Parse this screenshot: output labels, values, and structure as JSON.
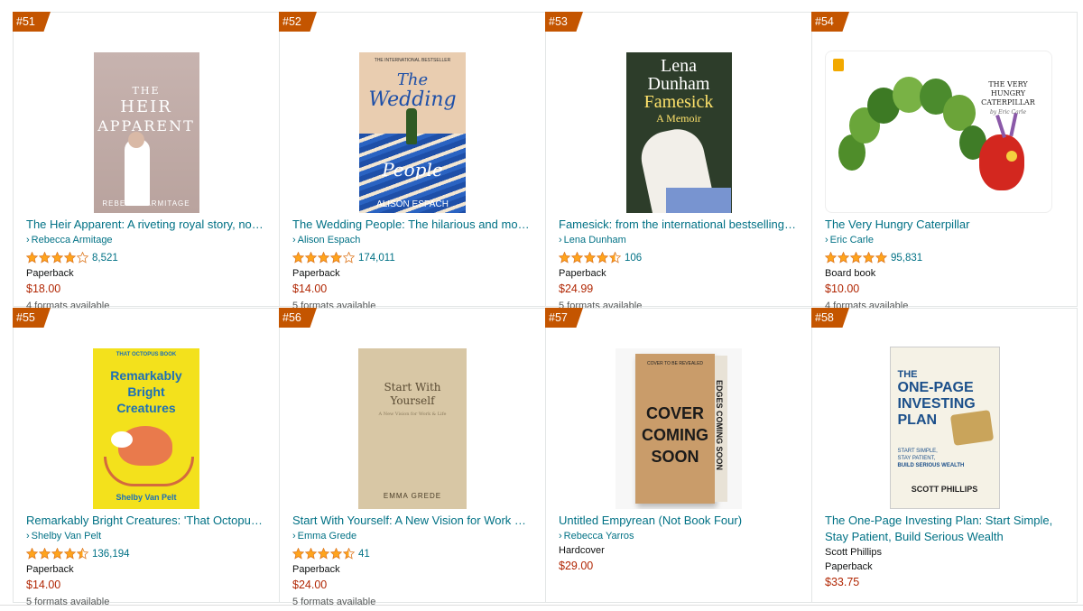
{
  "books": [
    {
      "rank": "#51",
      "title": "The Heir Apparent: A riveting royal story, no…",
      "author": "Rebecca Armitage",
      "author_link": true,
      "rating": 4.0,
      "reviews": "8,521",
      "format": "Paperback",
      "price": "$18.00",
      "formats_available": "4 formats available",
      "cover_text": {
        "line1": "THE",
        "line2": "HEIR",
        "line3": "APPARENT",
        "author": "REBECCA ARMITAGE"
      }
    },
    {
      "rank": "#52",
      "title": "The Wedding People: The hilarious and movi…",
      "author": "Alison Espach",
      "author_link": true,
      "rating": 4.0,
      "reviews": "174,011",
      "format": "Paperback",
      "price": "$14.00",
      "formats_available": "5 formats available",
      "cover_text": {
        "top": "THE INTERNATIONAL BESTSELLER",
        "line1": "The",
        "line2": "Wedding",
        "line3": "People",
        "author": "ALISON ESPACH"
      }
    },
    {
      "rank": "#53",
      "title": "Famesick: from the international bestselling…",
      "author": "Lena Dunham",
      "author_link": true,
      "rating": 4.5,
      "reviews": "106",
      "format": "Paperback",
      "price": "$24.99",
      "formats_available": "5 formats available",
      "cover_text": {
        "line1": "Lena",
        "line2": "Dunham",
        "line3": "Famesick",
        "line4": "A Memoir"
      }
    },
    {
      "rank": "#54",
      "title": "The Very Hungry Caterpillar",
      "author": "Eric Carle",
      "author_link": true,
      "rating": 5.0,
      "reviews": "95,831",
      "format": "Board book",
      "price": "$10.00",
      "formats_available": "4 formats available",
      "cover_text": {
        "line1": "THE VERY",
        "line2": "HUNGRY",
        "line3": "CATERPILLAR",
        "author": "by Eric Carle"
      }
    },
    {
      "rank": "#55",
      "title": "Remarkably Bright Creatures: 'That Octopus…",
      "author": "Shelby Van Pelt",
      "author_link": true,
      "rating": 4.5,
      "reviews": "136,194",
      "format": "Paperback",
      "price": "$14.00",
      "formats_available": "5 formats available",
      "cover_text": {
        "top": "THAT OCTOPUS BOOK",
        "line1": "Remarkably",
        "line2": "Bright",
        "line3": "Creatures",
        "author": "Shelby Van Pelt"
      }
    },
    {
      "rank": "#56",
      "title": "Start With Yourself: A New Vision for Work &…",
      "author": "Emma Grede",
      "author_link": true,
      "rating": 4.5,
      "reviews": "41",
      "format": "Paperback",
      "price": "$24.00",
      "formats_available": "5 formats available",
      "cover_text": {
        "line1": "Start With",
        "line2": "Yourself",
        "line3": "A New Vision for Work & Life",
        "author": "EMMA GREDE"
      }
    },
    {
      "rank": "#57",
      "title": "Untitled Empyrean (Not Book Four)",
      "author": "Rebecca Yarros",
      "author_link": true,
      "rating": null,
      "reviews": "",
      "format": "Hardcover",
      "price": "$29.00",
      "formats_available": "",
      "cover_text": {
        "top": "COVER TO BE REVEALED",
        "line1": "COVER",
        "line2": "COMING",
        "line3": "SOON",
        "spine": "EDGES COMING SOON"
      }
    },
    {
      "rank": "#58",
      "title": "The One-Page Investing Plan: Start Simple, Stay Patient, Build Serious Wealth",
      "author": "Scott Phillips",
      "author_link": false,
      "rating": null,
      "reviews": "",
      "format": "Paperback",
      "price": "$33.75",
      "formats_available": "",
      "cover_text": {
        "line1": "THE",
        "line2": "ONE-PAGE",
        "line3": "INVESTING",
        "line4": "PLAN",
        "tag1": "START SIMPLE,",
        "tag2": "STAY PATIENT,",
        "tag3": "BUILD SERIOUS WEALTH",
        "author": "SCOTT PHILLIPS"
      }
    }
  ],
  "colors": {
    "badge": "#c45500",
    "link": "#007185",
    "price": "#b12704",
    "star": "#ffa41c"
  }
}
